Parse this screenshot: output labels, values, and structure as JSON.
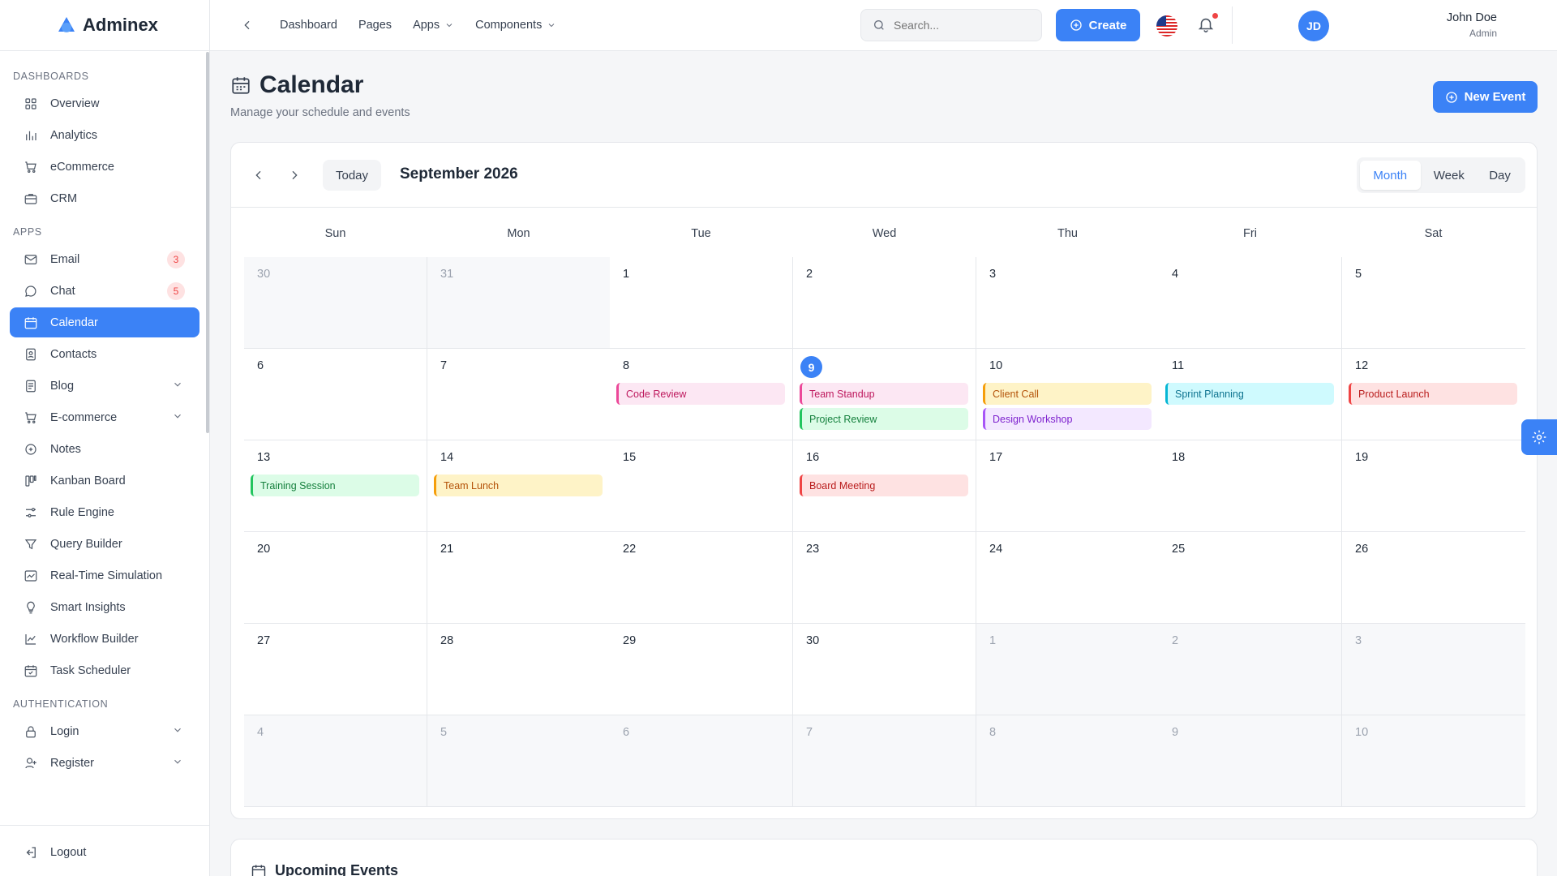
{
  "brand": {
    "name": "Adminex"
  },
  "sidebar": {
    "sections": [
      {
        "title": "Dashboards",
        "items": [
          {
            "label": "Overview",
            "icon": "grid-icon"
          },
          {
            "label": "Analytics",
            "icon": "bar-chart-icon"
          },
          {
            "label": "eCommerce",
            "icon": "cart-icon"
          },
          {
            "label": "CRM",
            "icon": "briefcase-icon"
          }
        ]
      },
      {
        "title": "Apps",
        "items": [
          {
            "label": "Email",
            "icon": "mail-icon",
            "badge": "3"
          },
          {
            "label": "Chat",
            "icon": "chat-icon",
            "badge": "5"
          },
          {
            "label": "Calendar",
            "icon": "calendar-icon",
            "active": true
          },
          {
            "label": "Contacts",
            "icon": "contacts-icon"
          },
          {
            "label": "Blog",
            "icon": "document-icon",
            "expandable": true
          },
          {
            "label": "E-commerce",
            "icon": "cart-icon",
            "expandable": true
          },
          {
            "label": "Notes",
            "icon": "notes-icon"
          },
          {
            "label": "Kanban Board",
            "icon": "kanban-icon"
          },
          {
            "label": "Rule Engine",
            "icon": "sliders-icon"
          },
          {
            "label": "Query Builder",
            "icon": "funnel-icon"
          },
          {
            "label": "Real-Time Simulation",
            "icon": "image-chart-icon"
          },
          {
            "label": "Smart Insights",
            "icon": "lightbulb-icon"
          },
          {
            "label": "Workflow Builder",
            "icon": "line-chart-icon"
          },
          {
            "label": "Task Scheduler",
            "icon": "calendar-check-icon"
          }
        ]
      },
      {
        "title": "Authentication",
        "items": [
          {
            "label": "Login",
            "icon": "lock-icon",
            "expandable": true
          },
          {
            "label": "Register",
            "icon": "user-plus-icon",
            "expandable": true
          }
        ]
      }
    ],
    "logout": "Logout"
  },
  "topbar": {
    "nav": [
      {
        "label": "Dashboard"
      },
      {
        "label": "Pages"
      },
      {
        "label": "Apps",
        "dropdown": true
      },
      {
        "label": "Components",
        "dropdown": true
      }
    ],
    "search_placeholder": "Search...",
    "create_label": "Create",
    "user": {
      "name": "John Doe",
      "role": "Admin",
      "initials": "JD"
    }
  },
  "page": {
    "title": "Calendar",
    "subtitle": "Manage your schedule and events",
    "new_event_label": "New Event"
  },
  "calendar": {
    "today_label": "Today",
    "month_label": "September 2026",
    "views": [
      "Month",
      "Week",
      "Day"
    ],
    "selected_view": "Month",
    "weekdays": [
      "Sun",
      "Mon",
      "Tue",
      "Wed",
      "Thu",
      "Fri",
      "Sat"
    ],
    "weeks": [
      [
        {
          "d": "30",
          "o": true
        },
        {
          "d": "31",
          "o": true
        },
        {
          "d": "1"
        },
        {
          "d": "2"
        },
        {
          "d": "3"
        },
        {
          "d": "4"
        },
        {
          "d": "5"
        }
      ],
      [
        {
          "d": "6"
        },
        {
          "d": "7"
        },
        {
          "d": "8",
          "events": [
            {
              "t": "Code Review",
              "c": "pink"
            }
          ]
        },
        {
          "d": "9",
          "today": true,
          "events": [
            {
              "t": "Team Standup",
              "c": "pink"
            },
            {
              "t": "Project Review",
              "c": "green"
            }
          ]
        },
        {
          "d": "10",
          "events": [
            {
              "t": "Client Call",
              "c": "yellow"
            },
            {
              "t": "Design Workshop",
              "c": "purple"
            }
          ]
        },
        {
          "d": "11",
          "events": [
            {
              "t": "Sprint Planning",
              "c": "cyan"
            }
          ]
        },
        {
          "d": "12",
          "events": [
            {
              "t": "Product Launch",
              "c": "red"
            }
          ]
        }
      ],
      [
        {
          "d": "13",
          "events": [
            {
              "t": "Training Session",
              "c": "green"
            }
          ]
        },
        {
          "d": "14",
          "events": [
            {
              "t": "Team Lunch",
              "c": "yellow"
            }
          ]
        },
        {
          "d": "15"
        },
        {
          "d": "16",
          "events": [
            {
              "t": "Board Meeting",
              "c": "red"
            }
          ]
        },
        {
          "d": "17"
        },
        {
          "d": "18"
        },
        {
          "d": "19"
        }
      ],
      [
        {
          "d": "20"
        },
        {
          "d": "21"
        },
        {
          "d": "22"
        },
        {
          "d": "23"
        },
        {
          "d": "24"
        },
        {
          "d": "25"
        },
        {
          "d": "26"
        }
      ],
      [
        {
          "d": "27"
        },
        {
          "d": "28"
        },
        {
          "d": "29"
        },
        {
          "d": "30"
        },
        {
          "d": "1",
          "o": true
        },
        {
          "d": "2",
          "o": true
        },
        {
          "d": "3",
          "o": true
        }
      ],
      [
        {
          "d": "4",
          "o": true
        },
        {
          "d": "5",
          "o": true
        },
        {
          "d": "6",
          "o": true
        },
        {
          "d": "7",
          "o": true
        },
        {
          "d": "8",
          "o": true
        },
        {
          "d": "9",
          "o": true
        },
        {
          "d": "10",
          "o": true
        }
      ]
    ]
  },
  "upcoming": {
    "title": "Upcoming Events"
  },
  "colors": {
    "accent": "#3b82f6",
    "danger": "#ef4444"
  }
}
